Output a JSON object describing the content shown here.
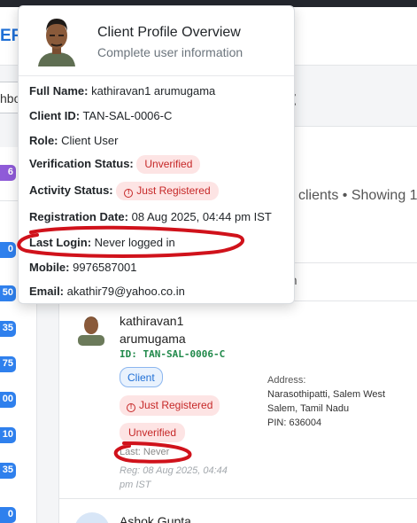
{
  "app": {
    "brand_fragment": "ER",
    "search_fragment": "hbo",
    "heading_fragment": "t",
    "clients_summary": "clients • Showing 1",
    "column_fragment": "tion"
  },
  "sidebar": {
    "badges": [
      "6",
      "0",
      "50",
      "35",
      "75",
      "00",
      "10",
      "35",
      "0"
    ]
  },
  "popover": {
    "title": "Client Profile Overview",
    "subtitle": "Complete user information",
    "fields": {
      "full_name_label": "Full Name:",
      "full_name": "kathiravan1 arumugama",
      "client_id_label": "Client ID:",
      "client_id": "TAN-SAL-0006-C",
      "role_label": "Role:",
      "role": "Client User",
      "verification_label": "Verification Status:",
      "verification": "Unverified",
      "activity_label": "Activity Status:",
      "activity": "Just Registered",
      "registration_label": "Registration Date:",
      "registration": "08 Aug 2025, 04:44 pm IST",
      "last_login_label": "Last Login:",
      "last_login": "Never logged in",
      "mobile_label": "Mobile:",
      "mobile": "9976587001",
      "email_label": "Email:",
      "email": "akathir79@yahoo.co.in"
    }
  },
  "client_row": {
    "name_line1": "kathiravan1",
    "name_line2": "arumugama",
    "client_id": "ID: TAN-SAL-0006-C",
    "role_badge": "Client",
    "status_badge": "Just Registered",
    "verify_badge": "Unverified",
    "last_login": "Last: Never",
    "reg_line": "Reg: 08 Aug 2025, 04:44 pm IST",
    "address_label": "Address:",
    "address_line1": "Narasothipatti, Salem West",
    "address_line2": "Salem, Tamil Nadu",
    "address_line3": "PIN: 636004"
  },
  "next_row": {
    "name": "Ashok Gupta"
  },
  "colors": {
    "brand_blue": "#1f6fd6",
    "danger_red": "#c62828",
    "danger_bg": "#fde4e4",
    "success_green": "#20894a",
    "annotation_red": "#d0121b"
  },
  "icons": {
    "info": "info-circle-icon",
    "user": "user-avatar-icon"
  }
}
